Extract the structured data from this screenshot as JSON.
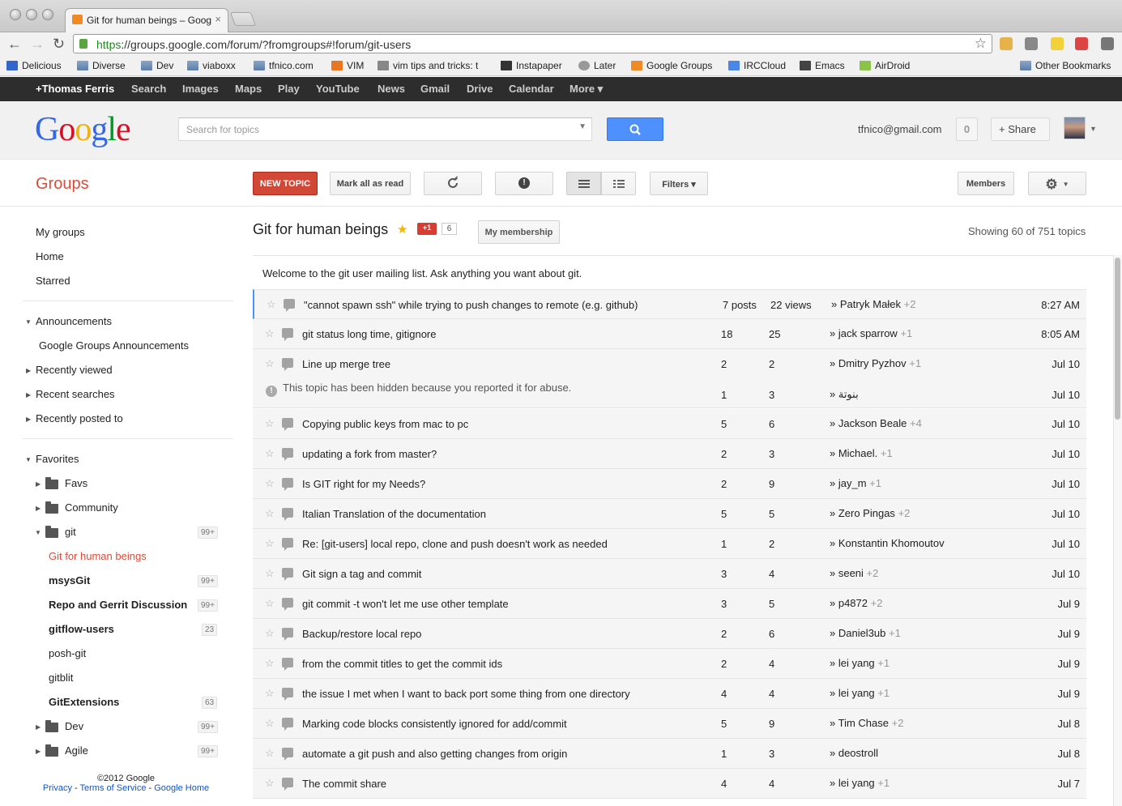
{
  "browser": {
    "tab_title": "Git for human beings – Goog",
    "url_scheme": "https",
    "url_rest": "://groups.google.com/forum/?fromgroups#!forum/git-users"
  },
  "bookmarks": [
    "Delicious",
    "Diverse",
    "Dev",
    "viaboxx",
    "tfnico.com",
    "VIM",
    "vim tips and tricks: t",
    "Instapaper",
    "Later",
    "Google Groups",
    "IRCCloud",
    "Emacs",
    "AirDroid",
    "Other Bookmarks"
  ],
  "gbar": [
    "+Thomas Ferris",
    "Search",
    "Images",
    "Maps",
    "Play",
    "YouTube",
    "News",
    "Gmail",
    "Drive",
    "Calendar",
    "More ▾"
  ],
  "header": {
    "search_placeholder": "Search for topics",
    "email": "tfnico@gmail.com",
    "notifications": "0",
    "share": "+ Share"
  },
  "toolbar": {
    "groups": "Groups",
    "new_topic": "NEW TOPIC",
    "mark_all": "Mark all as read",
    "filters": "Filters ▾",
    "members": "Members"
  },
  "sidebar": {
    "my_groups": "My groups",
    "home": "Home",
    "starred": "Starred",
    "announcements": "Announcements",
    "google_groups_announcements": "Google Groups Announcements",
    "recently_viewed": "Recently viewed",
    "recent_searches": "Recent searches",
    "recently_posted": "Recently posted to",
    "favorites": "Favorites",
    "favs": "Favs",
    "community": "Community",
    "git": "git",
    "git_count": "99+",
    "git_human": "Git for human beings",
    "msysgit": "msysGit",
    "msysgit_count": "99+",
    "repo_gerrit": "Repo and Gerrit Discussion",
    "repo_gerrit_count": "99+",
    "gitflow": "gitflow-users",
    "gitflow_count": "23",
    "poshgit": "posh-git",
    "gitblit": "gitblit",
    "gitextensions": "GitExtensions",
    "gitextensions_count": "63",
    "dev": "Dev",
    "dev_count": "99+",
    "agile": "Agile",
    "agile_count": "99+"
  },
  "footer": {
    "copyright": "©2012 Google",
    "privacy": "Privacy",
    "terms": "Terms of Service",
    "home": "Google Home"
  },
  "main": {
    "group_title": "Git for human beings",
    "plusone": "+1",
    "plusone_count": "6",
    "membership": "My membership",
    "showing": "Showing 60 of 751 topics",
    "welcome": "Welcome to the git user mailing list. Ask anything you want about git."
  },
  "topics": [
    {
      "subject": "\"cannot spawn ssh\" while trying to push changes to remote (e.g. github)",
      "posts": "7 posts",
      "views": "22 views",
      "author": "Patryk Małek",
      "plus": "+2",
      "date": "8:27 AM"
    },
    {
      "subject": "git status long time, gitignore",
      "posts": "18",
      "views": "25",
      "author": "jack sparrow",
      "plus": "+1",
      "date": "8:05 AM"
    },
    {
      "subject": "Line up merge tree",
      "posts": "2",
      "views": "2",
      "author": "Dmitry Pyzhov",
      "plus": "+1",
      "date": "Jul 10"
    },
    {
      "hidden": true,
      "subject": "This topic has been hidden because you reported it for abuse.",
      "posts": "1",
      "views": "3",
      "author": "بنوتة",
      "plus": "",
      "date": "Jul 10"
    },
    {
      "subject": "Copying public keys from mac to pc",
      "posts": "5",
      "views": "6",
      "author": "Jackson Beale",
      "plus": "+4",
      "date": "Jul 10"
    },
    {
      "subject": "updating a fork from master?",
      "posts": "2",
      "views": "3",
      "author": "Michael.",
      "plus": "+1",
      "date": "Jul 10"
    },
    {
      "subject": "Is GIT right for my Needs?",
      "posts": "2",
      "views": "9",
      "author": "jay_m",
      "plus": "+1",
      "date": "Jul 10"
    },
    {
      "subject": "Italian Translation of the documentation",
      "posts": "5",
      "views": "5",
      "author": "Zero Pingas",
      "plus": "+2",
      "date": "Jul 10"
    },
    {
      "subject": "Re: [git-users] local repo, clone and push doesn't work as needed",
      "posts": "1",
      "views": "2",
      "author": "Konstantin Khomoutov",
      "plus": "",
      "date": "Jul 10"
    },
    {
      "subject": "Git sign a tag and commit",
      "posts": "3",
      "views": "4",
      "author": "seeni",
      "plus": "+2",
      "date": "Jul 10"
    },
    {
      "subject": "git commit -t won't let me use other template",
      "posts": "3",
      "views": "5",
      "author": "p4872",
      "plus": "+2",
      "date": "Jul 9"
    },
    {
      "subject": "Backup/restore local repo",
      "posts": "2",
      "views": "6",
      "author": "Daniel3ub",
      "plus": "+1",
      "date": "Jul 9"
    },
    {
      "subject": "from the commit titles to get the commit ids",
      "posts": "2",
      "views": "4",
      "author": "lei yang",
      "plus": "+1",
      "date": "Jul 9"
    },
    {
      "subject": "the issue I met when I want to back port some thing from one directory",
      "posts": "4",
      "views": "4",
      "author": "lei yang",
      "plus": "+1",
      "date": "Jul 9"
    },
    {
      "subject": "Marking code blocks consistently ignored for add/commit",
      "posts": "5",
      "views": "9",
      "author": "Tim Chase",
      "plus": "+2",
      "date": "Jul 8"
    },
    {
      "subject": "automate a git push and also getting changes from origin",
      "posts": "1",
      "views": "3",
      "author": "deostroll",
      "plus": "",
      "date": "Jul 8"
    },
    {
      "subject": "The commit share",
      "posts": "4",
      "views": "4",
      "author": "lei yang",
      "plus": "+1",
      "date": "Jul 7"
    }
  ]
}
